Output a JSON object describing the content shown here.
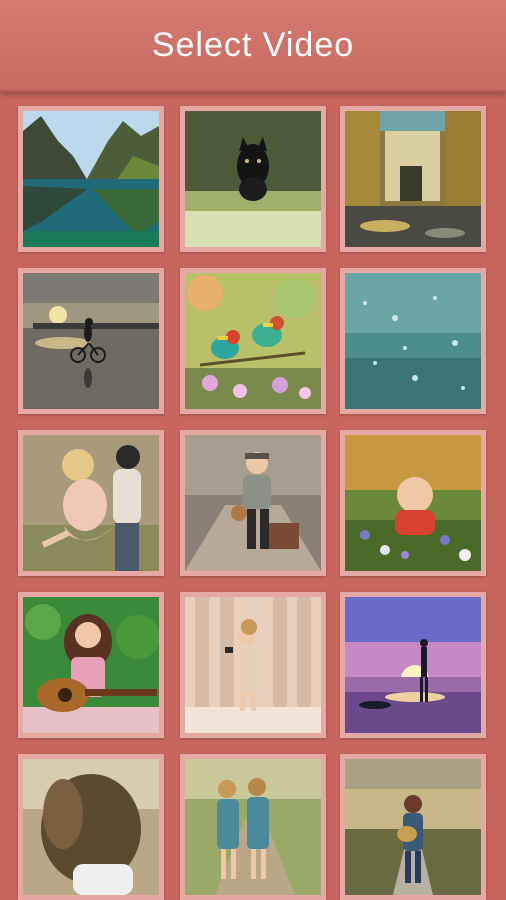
{
  "header": {
    "title": "Select Video"
  },
  "videos": [
    {
      "name": "mountain-lake"
    },
    {
      "name": "black-cat"
    },
    {
      "name": "rainy-street"
    },
    {
      "name": "sunset-cyclist"
    },
    {
      "name": "bee-eater-birds"
    },
    {
      "name": "rain-drops"
    },
    {
      "name": "embracing-couple"
    },
    {
      "name": "boy-with-suitcase"
    },
    {
      "name": "smiling-baby"
    },
    {
      "name": "girl-with-guitar"
    },
    {
      "name": "girl-with-camera"
    },
    {
      "name": "silhouette-sunset"
    },
    {
      "name": "windblown-hair"
    },
    {
      "name": "twin-girls"
    },
    {
      "name": "guitar-road"
    }
  ]
}
